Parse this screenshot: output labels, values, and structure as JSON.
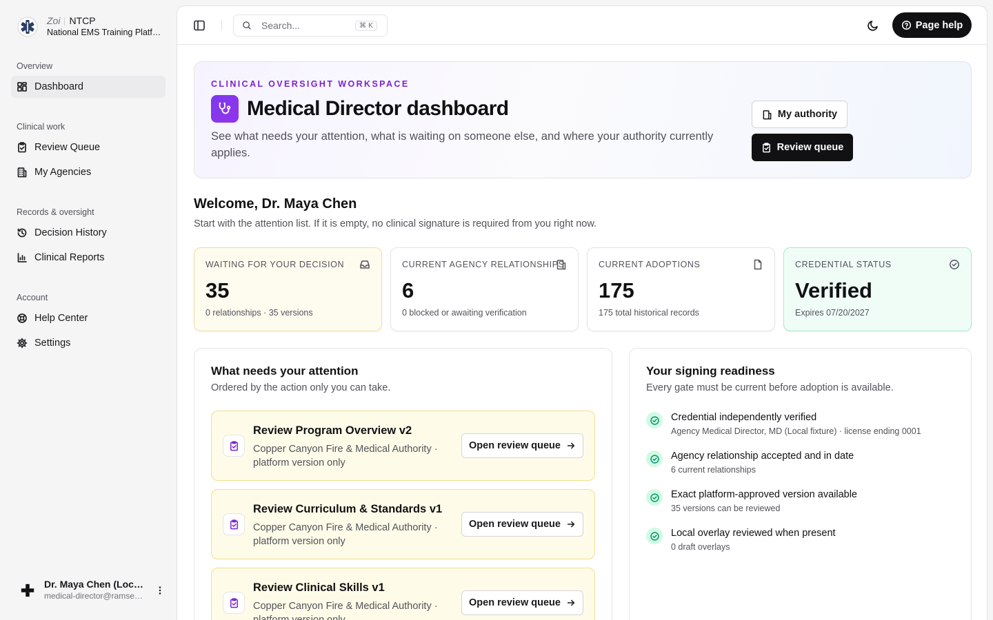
{
  "brand": {
    "zoi": "Zoi",
    "short": "NTCP",
    "full": "National EMS Training Platform"
  },
  "sidebar": {
    "groups": [
      {
        "label": "Overview",
        "items": [
          {
            "label": "Dashboard",
            "icon": "dashboard-icon",
            "active": true
          }
        ]
      },
      {
        "label": "Clinical work",
        "items": [
          {
            "label": "Review Queue",
            "icon": "clipboard-check-icon"
          },
          {
            "label": "My Agencies",
            "icon": "building-icon"
          }
        ]
      },
      {
        "label": "Records & oversight",
        "items": [
          {
            "label": "Decision History",
            "icon": "history-icon"
          },
          {
            "label": "Clinical Reports",
            "icon": "bar-chart-icon"
          }
        ]
      },
      {
        "label": "Account",
        "items": [
          {
            "label": "Help Center",
            "icon": "lifebuoy-icon"
          },
          {
            "label": "Settings",
            "icon": "gear-icon"
          }
        ]
      }
    ],
    "user": {
      "name": "Dr. Maya Chen (Local fixture)",
      "email": "medical-director@ramsey.example"
    }
  },
  "topbar": {
    "search_placeholder": "Search...",
    "search_shortcut": "⌘ K",
    "help_label": "Page help"
  },
  "hero": {
    "eyebrow": "CLINICAL OVERSIGHT WORKSPACE",
    "title": "Medical Director dashboard",
    "description": "See what needs your attention, what is waiting on someone else, and where your authority currently applies.",
    "btn_authority": "My authority",
    "btn_queue": "Review queue"
  },
  "welcome": {
    "title": "Welcome, Dr. Maya Chen",
    "subtitle": "Start with the attention list. If it is empty, no clinical signature is required from you right now."
  },
  "stats": [
    {
      "label": "Waiting for your decision",
      "value": "35",
      "sub": "0 relationships · 35 versions",
      "icon": "inbox-icon",
      "tone": "warn"
    },
    {
      "label": "Current agency relationships",
      "value": "6",
      "sub": "0 blocked or awaiting verification",
      "icon": "building-icon",
      "tone": "plain"
    },
    {
      "label": "Current adoptions",
      "value": "175",
      "sub": "175 total historical records",
      "icon": "file-icon",
      "tone": "plain"
    },
    {
      "label": "Credential status",
      "value": "Verified",
      "sub": "Expires 07/20/2027",
      "icon": "check-circle-icon",
      "tone": "ok"
    }
  ],
  "attention": {
    "title": "What needs your attention",
    "subtitle": "Ordered by the action only you can take.",
    "items": [
      {
        "title": "Review Program Overview v2",
        "desc": "Copper Canyon Fire & Medical Authority · platform version only",
        "action": "Open review queue"
      },
      {
        "title": "Review Curriculum & Standards v1",
        "desc": "Copper Canyon Fire & Medical Authority · platform version only",
        "action": "Open review queue"
      },
      {
        "title": "Review Clinical Skills v1",
        "desc": "Copper Canyon Fire & Medical Authority · platform version only",
        "action": "Open review queue"
      }
    ]
  },
  "readiness": {
    "title": "Your signing readiness",
    "subtitle": "Every gate must be current before adoption is available.",
    "items": [
      {
        "title": "Credential independently verified",
        "sub": "Agency Medical Director, MD (Local fixture) · license ending 0001"
      },
      {
        "title": "Agency relationship accepted and in date",
        "sub": "6 current relationships"
      },
      {
        "title": "Exact platform-approved version available",
        "sub": "35 versions can be reviewed"
      },
      {
        "title": "Local overlay reviewed when present",
        "sub": "0 draft overlays"
      }
    ]
  },
  "colors": {
    "accent": "#7e22ce",
    "primary": "#111113",
    "warn_bg": "#fefce8",
    "ok_bg": "#f0fdf7"
  }
}
